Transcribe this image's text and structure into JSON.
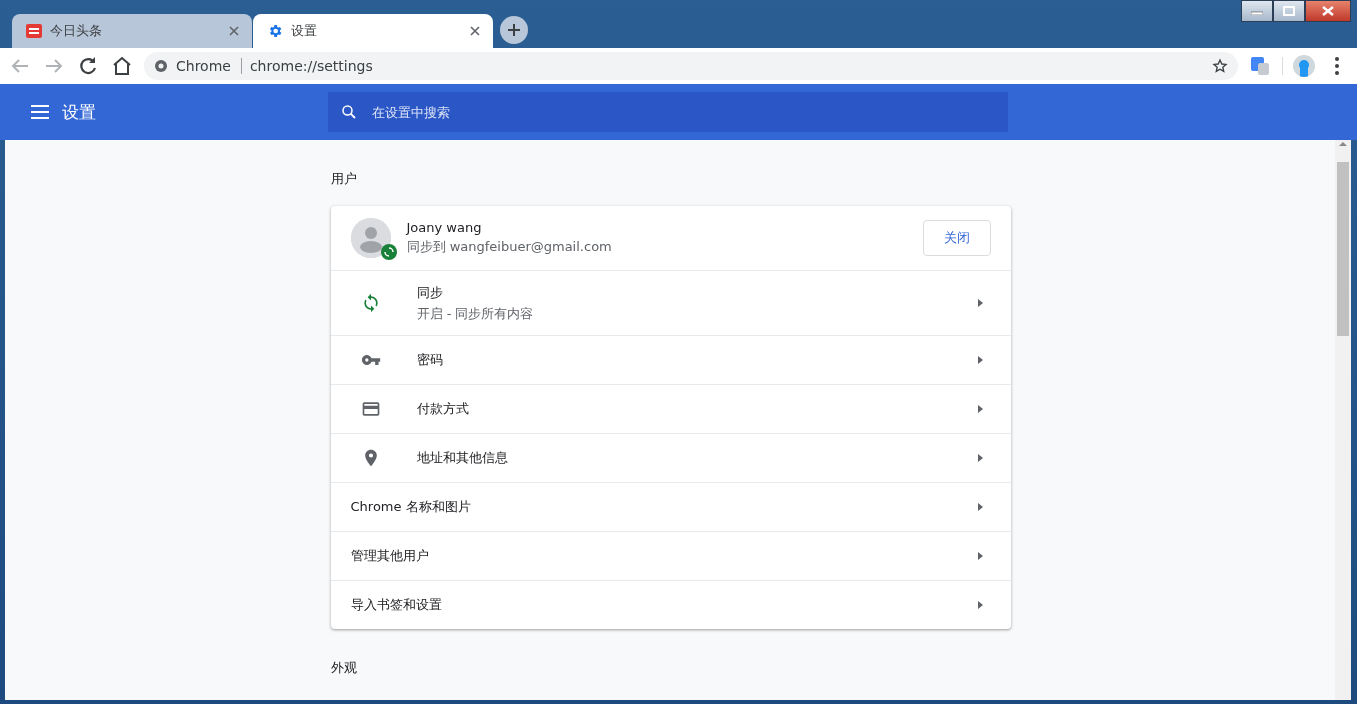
{
  "tabs": [
    {
      "title": "今日头条",
      "kind": "news",
      "selected": false
    },
    {
      "title": "设置",
      "kind": "settings",
      "selected": true
    }
  ],
  "address": {
    "site": "Chrome",
    "url": "chrome://settings"
  },
  "header": {
    "title": "设置",
    "search_placeholder": "在设置中搜索"
  },
  "sections": [
    {
      "title": "用户",
      "card": {
        "profile": {
          "name": "Joany wang",
          "detail": "同步到 wangfeibuer@gmail.com",
          "button": "关闭"
        },
        "rows": [
          {
            "kind": "sync",
            "label": "同步",
            "sublabel": "开启 - 同步所有内容"
          },
          {
            "kind": "password",
            "label": "密码"
          },
          {
            "kind": "payment",
            "label": "付款方式"
          },
          {
            "kind": "address",
            "label": "地址和其他信息"
          },
          {
            "kind": "plain",
            "label": "Chrome 名称和图片"
          },
          {
            "kind": "plain",
            "label": "管理其他用户"
          },
          {
            "kind": "plain",
            "label": "导入书签和设置"
          }
        ]
      }
    },
    {
      "title": "外观"
    }
  ]
}
